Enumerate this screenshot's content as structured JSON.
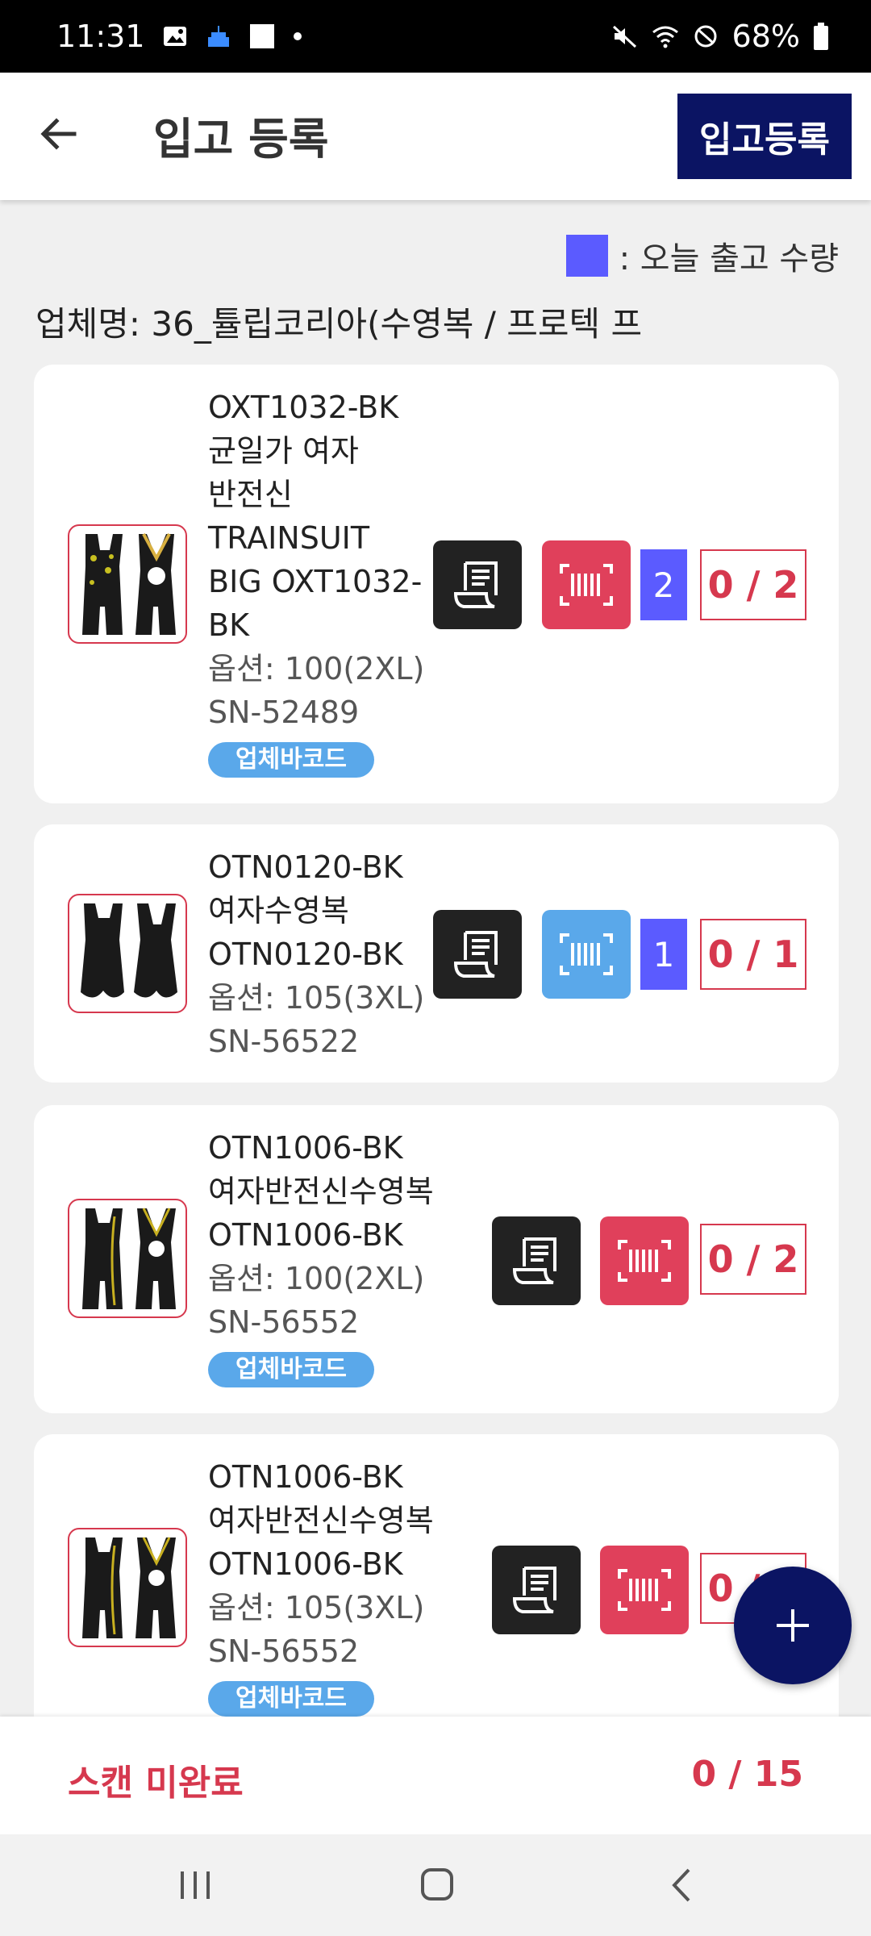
{
  "status_bar": {
    "time": "11:31",
    "battery": "68%",
    "icons": [
      "image-icon",
      "cake-icon",
      "square-icon",
      "dot-icon",
      "mute-icon",
      "wifi-icon",
      "blocked-icon",
      "battery-icon"
    ]
  },
  "header": {
    "title": "입고 등록",
    "register_button": "입고등록",
    "back_icon": "back-arrow-icon"
  },
  "legend": {
    "label": ": 오늘 출고 수량",
    "color": "#5b5bff"
  },
  "vendor": {
    "label": "업체명: 36_튤립코리아(수영복 / 프로텍 프"
  },
  "items": [
    {
      "name_lines": [
        "OXT1032-BK",
        "균일가 여자",
        "반전신",
        "TRAINSUIT",
        "BIG OXT1032-",
        "BK"
      ],
      "option": "옵션: 100(2XL)",
      "serial": "SN-52489",
      "badge": "업체바코드",
      "today_qty": "2",
      "count": "0 / 2",
      "barcode_color": "red"
    },
    {
      "name_lines": [
        "OTN0120-BK",
        "여자수영복",
        "OTN0120-BK"
      ],
      "option": "옵션: 105(3XL)",
      "serial": "SN-56522",
      "badge": "",
      "today_qty": "1",
      "count": "0 / 1",
      "barcode_color": "blue"
    },
    {
      "name_lines": [
        "OTN1006-BK",
        "여자반전신수영복",
        "OTN1006-BK"
      ],
      "option": "옵션: 100(2XL)",
      "serial": "SN-56552",
      "badge": "업체바코드",
      "today_qty": "",
      "count": "0 / 2",
      "barcode_color": "red"
    },
    {
      "name_lines": [
        "OTN1006-BK",
        "여자반전신수영복",
        "OTN1006-BK"
      ],
      "option": "옵션: 105(3XL)",
      "serial": "SN-56552",
      "badge": "업체바코드",
      "today_qty": "",
      "count": "0 / 2",
      "barcode_color": "red"
    }
  ],
  "footer": {
    "scan_status": "스캔 미완료",
    "scan_total": "0 / 15"
  },
  "colors": {
    "primary": "#0b1463",
    "accent_red": "#e0405b",
    "accent_blue": "#5aa8ea",
    "qty_blue": "#5b5bff"
  }
}
